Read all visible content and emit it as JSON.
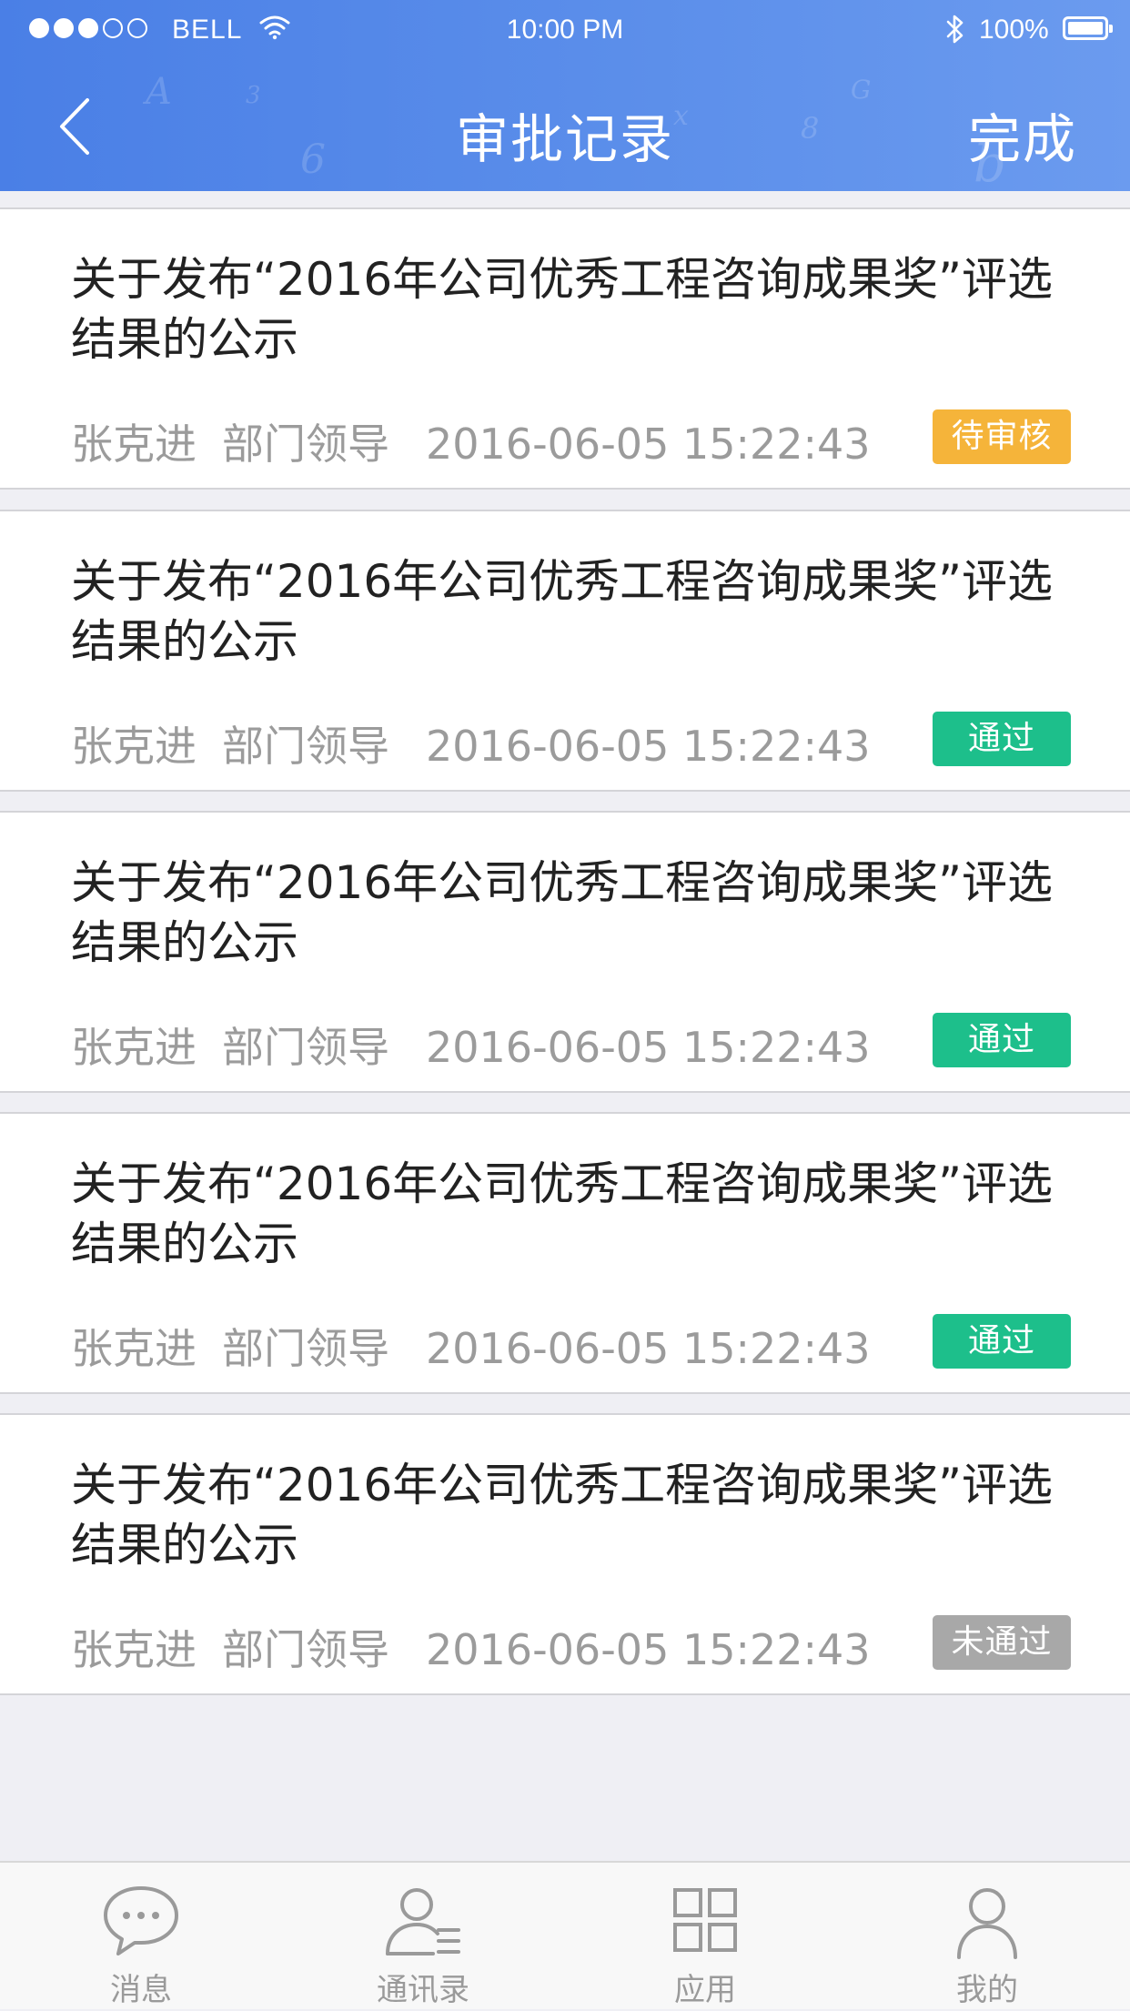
{
  "status_bar": {
    "signal_dots": [
      "on",
      "on",
      "on",
      "off",
      "off"
    ],
    "carrier": "BELL",
    "time": "10:00 PM",
    "battery_percent": "100%",
    "battery_level": 1.0
  },
  "nav": {
    "back_icon": "chevron-left-icon",
    "title": "审批记录",
    "done_label": "完成"
  },
  "records": [
    {
      "title": "关于发布“2016年公司优秀工程咨询成果奖”评选结果的公示",
      "person": "张克进",
      "role": "部门领导",
      "datetime": "2016-06-05  15:22:43",
      "status": "待审核",
      "status_color": "#f5b43a"
    },
    {
      "title": "关于发布“2016年公司优秀工程咨询成果奖”评选结果的公示",
      "person": "张克进",
      "role": "部门领导",
      "datetime": "2016-06-05  15:22:43",
      "status": "通过",
      "status_color": "#1dbf8b"
    },
    {
      "title": "关于发布“2016年公司优秀工程咨询成果奖”评选结果的公示",
      "person": "张克进",
      "role": "部门领导",
      "datetime": "2016-06-05  15:22:43",
      "status": "通过",
      "status_color": "#1dbf8b"
    },
    {
      "title": "关于发布“2016年公司优秀工程咨询成果奖”评选结果的公示",
      "person": "张克进",
      "role": "部门领导",
      "datetime": "2016-06-05  15:22:43",
      "status": "通过",
      "status_color": "#1dbf8b"
    },
    {
      "title": "关于发布“2016年公司优秀工程咨询成果奖”评选结果的公示",
      "person": "张克进",
      "role": "部门领导",
      "datetime": "2016-06-05  15:22:43",
      "status": "未通过",
      "status_color": "#a8a8a8"
    }
  ],
  "tabbar": {
    "tabs": [
      {
        "label": "消息",
        "icon": "message-bubble-icon"
      },
      {
        "label": "通讯录",
        "icon": "contacts-icon"
      },
      {
        "label": "应用",
        "icon": "apps-grid-icon"
      },
      {
        "label": "我的",
        "icon": "profile-icon"
      }
    ]
  },
  "colors": {
    "header_blue": "#5b8eea",
    "page_background": "#efeff4",
    "tab_icon_gray": "#9a9a9a"
  }
}
